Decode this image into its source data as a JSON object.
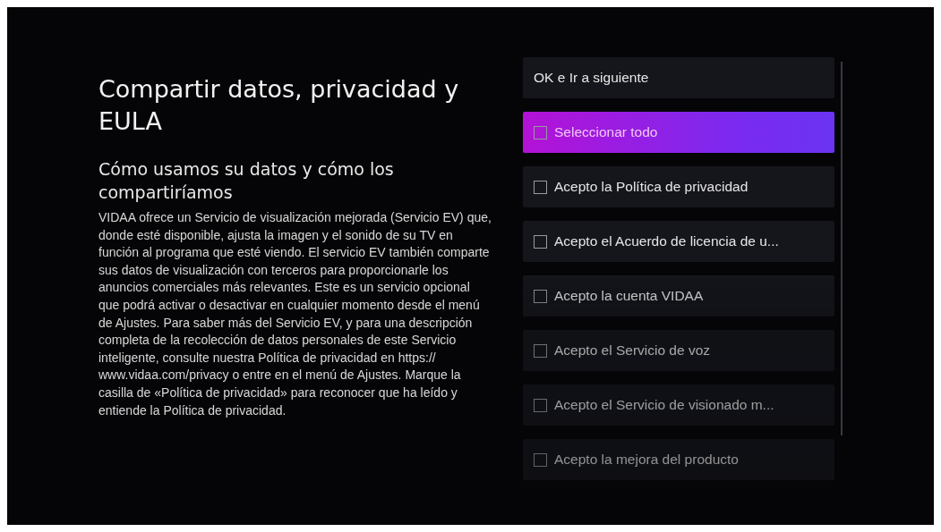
{
  "title": "Compartir datos, privacidad y EULA",
  "subtitle": "Cómo usamos su datos y cómo los compartiríamos",
  "body": "VIDAA ofrece un Servicio de visualización mejorada (Servicio EV) que, donde esté disponible, ajusta la imagen y el sonido de su TV en función al programa que esté viendo. El servicio EV también comparte sus datos de visualización con terceros para proporcionarle los anuncios comerciales más relevantes. Este es un servicio opcional que podrá activar o desactivar en cualquier momento desde el menú de Ajustes. Para saber más del Servicio EV, y para una descripción completa de la recolección de datos personales de este Servicio inteligente, consulte nuestra Política de privacidad en https:// www.vidaa.com/privacy o entre en el menú de Ajustes. Marque la casilla de «Política de privacidad» para reconocer que ha leído y entiende la Política de privacidad.",
  "options": [
    {
      "kind": "button",
      "label": "OK e Ir a siguiente",
      "selected": false
    },
    {
      "kind": "checkbox",
      "label": "Seleccionar todo",
      "selected": true,
      "checked": false
    },
    {
      "kind": "checkbox",
      "label": "Acepto la Política de privacidad",
      "selected": false,
      "checked": false
    },
    {
      "kind": "checkbox",
      "label": "Acepto el Acuerdo de licencia de u...",
      "selected": false,
      "checked": false
    },
    {
      "kind": "checkbox",
      "label": "Acepto la cuenta VIDAA",
      "selected": false,
      "checked": false
    },
    {
      "kind": "checkbox",
      "label": "Acepto el Servicio de voz",
      "selected": false,
      "checked": false
    },
    {
      "kind": "checkbox",
      "label": "Acepto el Servicio de visionado m...",
      "selected": false,
      "checked": false
    },
    {
      "kind": "checkbox",
      "label": "Acepto la mejora del producto",
      "selected": false,
      "checked": false
    }
  ]
}
